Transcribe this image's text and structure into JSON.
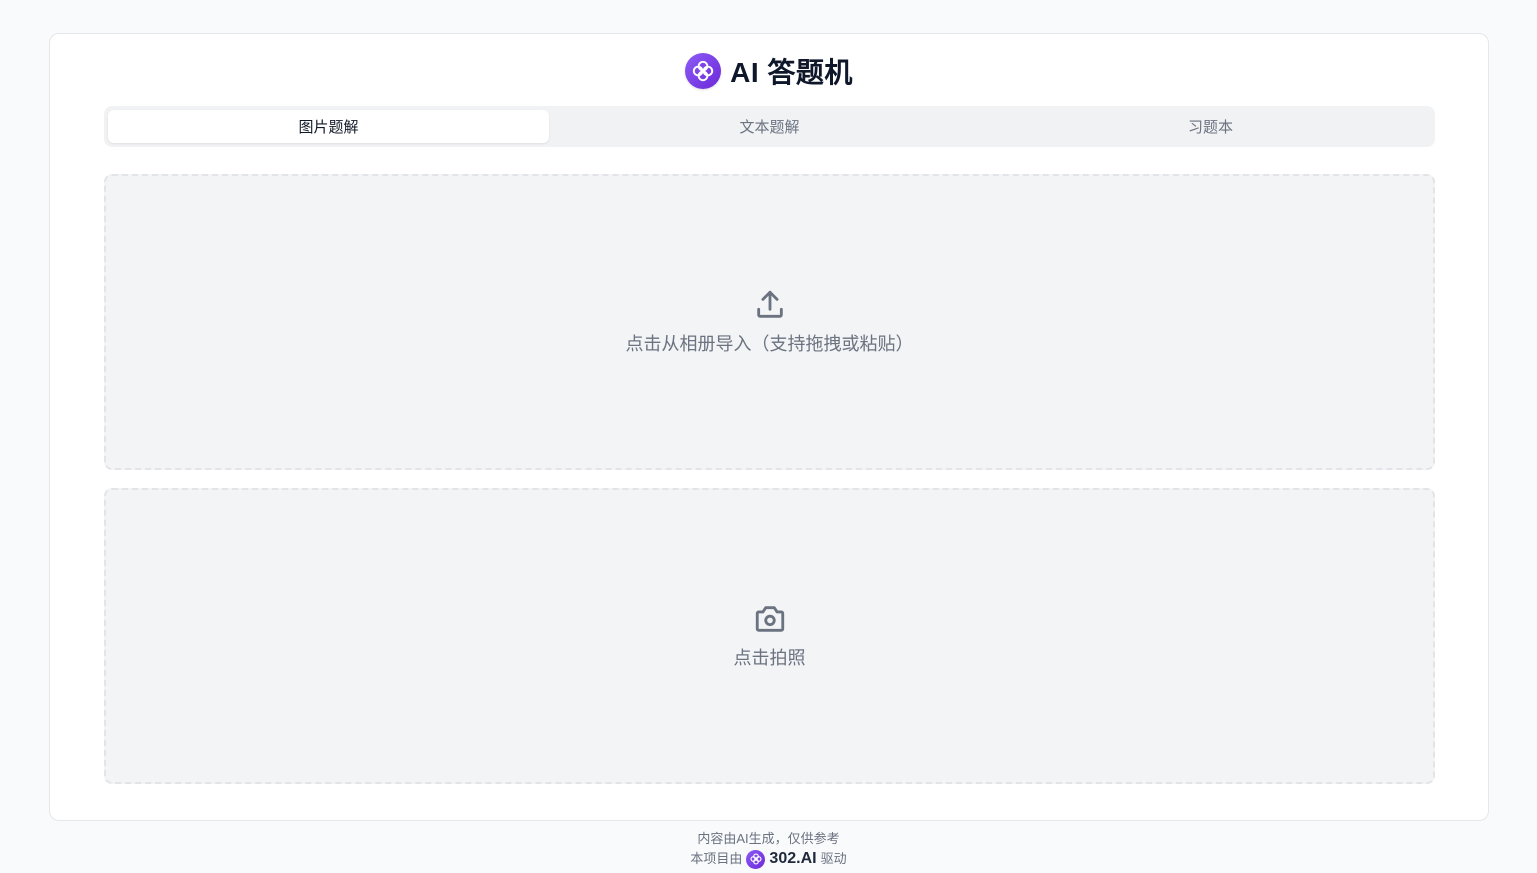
{
  "app": {
    "title": "AI 答题机",
    "logo_icon": "clover-logo-icon",
    "brand_color": "#7c3aed"
  },
  "tabs": [
    {
      "label": "图片题解",
      "active": true
    },
    {
      "label": "文本题解",
      "active": false
    },
    {
      "label": "习题本",
      "active": false
    }
  ],
  "upload": {
    "icon": "upload-icon",
    "label": "点击从相册导入（支持拖拽或粘贴）"
  },
  "camera": {
    "icon": "camera-icon",
    "label": "点击拍照"
  },
  "footer": {
    "disclaimer": "内容由AI生成，仅供参考",
    "powered_prefix": "本项目由",
    "brand": "302.AI",
    "powered_suffix": "驱动"
  }
}
